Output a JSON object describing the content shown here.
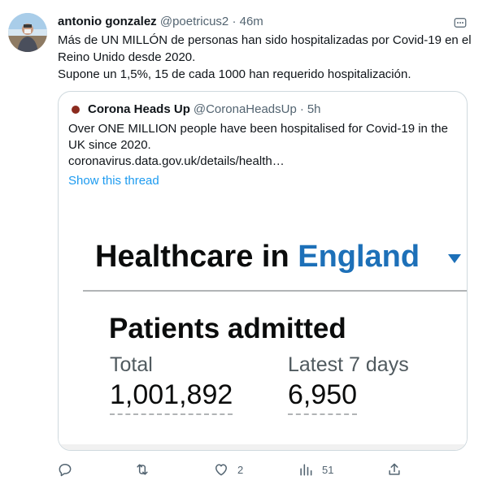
{
  "tweet": {
    "author_name": "antonio gonzalez",
    "author_handle": "@poetricus2",
    "separator": "·",
    "time": "46m",
    "text_line1": "Más de UN MILLÓN de personas han sido hospitalizadas por Covid-19 en el Reino Unido desde 2020.",
    "text_line2": "Supone un 1,5%, 15 de cada 1000 han requerido hospitalización."
  },
  "quote": {
    "author_name": "Corona Heads Up",
    "author_handle": "@CoronaHeadsUp",
    "separator": "·",
    "time": "5h",
    "text": "Over ONE MILLION people have been hospitalised for Covid-19 in the UK since 2020.",
    "link": "coronavirus.data.gov.uk/details/health…",
    "show_thread": "Show this thread",
    "media": {
      "title_prefix": "Healthcare in",
      "region": "England",
      "subtitle": "Patients admitted",
      "total_label": "Total",
      "total_value": "1,001,892",
      "latest_label": "Latest 7 days",
      "latest_value": "6,950"
    }
  },
  "actions": {
    "reply_count": "",
    "retweet_count": "",
    "like_count": "2",
    "views_count": "51"
  },
  "colors": {
    "link_blue": "#1d9bf0",
    "gov_blue": "#1d70b8",
    "secondary_text": "#536471",
    "border": "#cfd9de"
  },
  "icons": [
    "more-icon",
    "reply-icon",
    "retweet-icon",
    "like-icon",
    "views-icon",
    "share-icon"
  ]
}
